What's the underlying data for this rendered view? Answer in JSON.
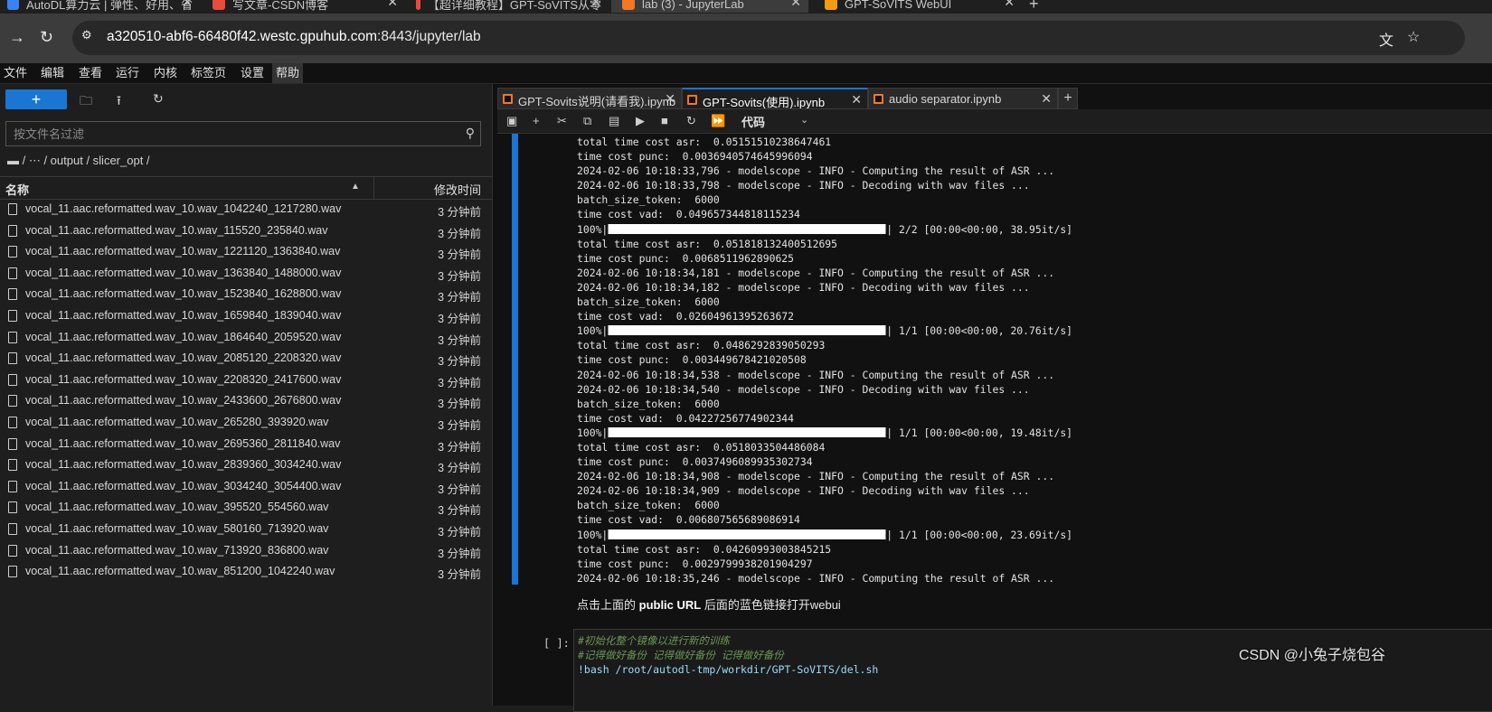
{
  "browser": {
    "tabs": [
      {
        "title": "AutoDL算力云 | 弹性、好用、省",
        "icon_color": "#3b82f6",
        "icon": "autodl-icon"
      },
      {
        "title": "写文章-CSDN博客",
        "icon_color": "#e74c3c",
        "icon": "csdn-icon"
      },
      {
        "title": "【超详细教程】GPT-SoVITS从零",
        "icon_color": "#e74c3c",
        "icon": "csdn-icon"
      },
      {
        "title": "lab (3) - JupyterLab",
        "icon_color": "#f37726",
        "icon": "jupyter-icon"
      },
      {
        "title": "GPT-SoVITS WebUI",
        "icon_color": "#f39c12",
        "icon": "gradio-icon"
      }
    ],
    "url_host": "a320510-abf6-66480f42.westc.gpuhub.com",
    "url_rest": ":8443/jupyter/lab"
  },
  "menu": [
    "文件",
    "编辑",
    "查看",
    "运行",
    "内核",
    "标签页",
    "设置",
    "帮助"
  ],
  "filebrowser": {
    "new_label": "+",
    "filter_placeholder": "按文件名过滤",
    "breadcrumb": "/  ⋯  / output / slicer_opt /",
    "col_name": "名称",
    "col_modified": "修改时间",
    "files": [
      {
        "name": "vocal_11.aac.reformatted.wav_10.wav_1042240_1217280.wav",
        "modified": "3 分钟前"
      },
      {
        "name": "vocal_11.aac.reformatted.wav_10.wav_115520_235840.wav",
        "modified": "3 分钟前"
      },
      {
        "name": "vocal_11.aac.reformatted.wav_10.wav_1221120_1363840.wav",
        "modified": "3 分钟前"
      },
      {
        "name": "vocal_11.aac.reformatted.wav_10.wav_1363840_1488000.wav",
        "modified": "3 分钟前"
      },
      {
        "name": "vocal_11.aac.reformatted.wav_10.wav_1523840_1628800.wav",
        "modified": "3 分钟前"
      },
      {
        "name": "vocal_11.aac.reformatted.wav_10.wav_1659840_1839040.wav",
        "modified": "3 分钟前"
      },
      {
        "name": "vocal_11.aac.reformatted.wav_10.wav_1864640_2059520.wav",
        "modified": "3 分钟前"
      },
      {
        "name": "vocal_11.aac.reformatted.wav_10.wav_2085120_2208320.wav",
        "modified": "3 分钟前"
      },
      {
        "name": "vocal_11.aac.reformatted.wav_10.wav_2208320_2417600.wav",
        "modified": "3 分钟前"
      },
      {
        "name": "vocal_11.aac.reformatted.wav_10.wav_2433600_2676800.wav",
        "modified": "3 分钟前"
      },
      {
        "name": "vocal_11.aac.reformatted.wav_10.wav_265280_393920.wav",
        "modified": "3 分钟前"
      },
      {
        "name": "vocal_11.aac.reformatted.wav_10.wav_2695360_2811840.wav",
        "modified": "3 分钟前"
      },
      {
        "name": "vocal_11.aac.reformatted.wav_10.wav_2839360_3034240.wav",
        "modified": "3 分钟前"
      },
      {
        "name": "vocal_11.aac.reformatted.wav_10.wav_3034240_3054400.wav",
        "modified": "3 分钟前"
      },
      {
        "name": "vocal_11.aac.reformatted.wav_10.wav_395520_554560.wav",
        "modified": "3 分钟前"
      },
      {
        "name": "vocal_11.aac.reformatted.wav_10.wav_580160_713920.wav",
        "modified": "3 分钟前"
      },
      {
        "name": "vocal_11.aac.reformatted.wav_10.wav_713920_836800.wav",
        "modified": "3 分钟前"
      },
      {
        "name": "vocal_11.aac.reformatted.wav_10.wav_851200_1042240.wav",
        "modified": "3 分钟前"
      }
    ]
  },
  "notebook": {
    "tabs": [
      {
        "title": "GPT-Sovits说明(请看我).ipynb",
        "active": false
      },
      {
        "title": "GPT-Sovits(使用).ipynb",
        "active": true
      },
      {
        "title": "audio separator.ipynb",
        "active": false
      }
    ],
    "cell_type": "代码",
    "output_lines": [
      {
        "text": "total time cost asr:  0.05151510238647461"
      },
      {
        "text": "time cost punc:  0.0036940574645996094"
      },
      {
        "text": "2024-02-06 10:18:33,796 - modelscope - INFO - Computing the result of ASR ..."
      },
      {
        "text": "2024-02-06 10:18:33,798 - modelscope - INFO - Decoding with wav files ..."
      },
      {
        "text": "batch_size_token:  6000"
      },
      {
        "text": "time cost vad:  0.049657344818115234"
      },
      {
        "pre": "100%|",
        "progress": 1.0,
        "text": "| 2/2 [00:00<00:00, 38.95it/s]"
      },
      {
        "text": "total time cost asr:  0.05181813240051269​5"
      },
      {
        "text": "time cost punc:  0.0068511962890625"
      },
      {
        "text": "2024-02-06 10:18:34,181 - modelscope - INFO - Computing the result of ASR ..."
      },
      {
        "text": "2024-02-06 10:18:34,182 - modelscope - INFO - Decoding with wav files ..."
      },
      {
        "text": "batch_size_token:  6000"
      },
      {
        "text": "time cost vad:  0.02604961395263672"
      },
      {
        "pre": "100%|",
        "progress": 1.0,
        "text": "| 1/1 [00:00<00:00, 20.76it/s]"
      },
      {
        "text": "total time cost asr:  0.0486292839050293"
      },
      {
        "text": "time cost punc:  0.003449678421020508"
      },
      {
        "text": "2024-02-06 10:18:34,538 - modelscope - INFO - Computing the result of ASR ..."
      },
      {
        "text": "2024-02-06 10:18:34,540 - modelscope - INFO - Decoding with wav files ..."
      },
      {
        "text": "batch_size_token:  6000"
      },
      {
        "text": "time cost vad:  0.04227256774902344"
      },
      {
        "pre": "100%|",
        "progress": 1.0,
        "text": "| 1/1 [00:00<00:00, 19.48it/s]"
      },
      {
        "text": "total time cost asr:  0.0518033504486084"
      },
      {
        "text": "time cost punc:  0.003749608993530273​4"
      },
      {
        "text": "2024-02-06 10:18:34,908 - modelscope - INFO - Computing the result of ASR ..."
      },
      {
        "text": "2024-02-06 10:18:34,909 - modelscope - INFO - Decoding with wav files ..."
      },
      {
        "text": "batch_size_token:  6000"
      },
      {
        "text": "time cost vad:  0.006807565689086914"
      },
      {
        "pre": "100%|",
        "progress": 1.0,
        "text": "| 1/1 [00:00<00:00, 23.69it/s]"
      },
      {
        "text": "total time cost asr:  0.04260993003845215"
      },
      {
        "text": "time cost punc:  0.0029799938201904297"
      },
      {
        "text": "2024-02-06 10:18:35,246 - modelscope - INFO - Computing the result of ASR ..."
      }
    ],
    "markdown_before": "点击上面的 ",
    "markdown_bold": "public URL",
    "markdown_after": " 后面的蓝色链接打开webui",
    "code_prompt": "[ ]:",
    "code_lines": [
      {
        "text": "#初始化整个镜像以进行新的训练",
        "kind": "comment"
      },
      {
        "text": "#记得做好备份 记得做好备份 记得做好备份",
        "kind": "comment"
      },
      {
        "text": "!bash /root/autodl-tmp/workdir/GPT-SoVITS/del.sh",
        "kind": "code"
      }
    ]
  },
  "watermark": "CSDN @小兔子烧包谷",
  "colors": {
    "accent": "#1976d2",
    "jupyter_orange": "#f37726"
  }
}
